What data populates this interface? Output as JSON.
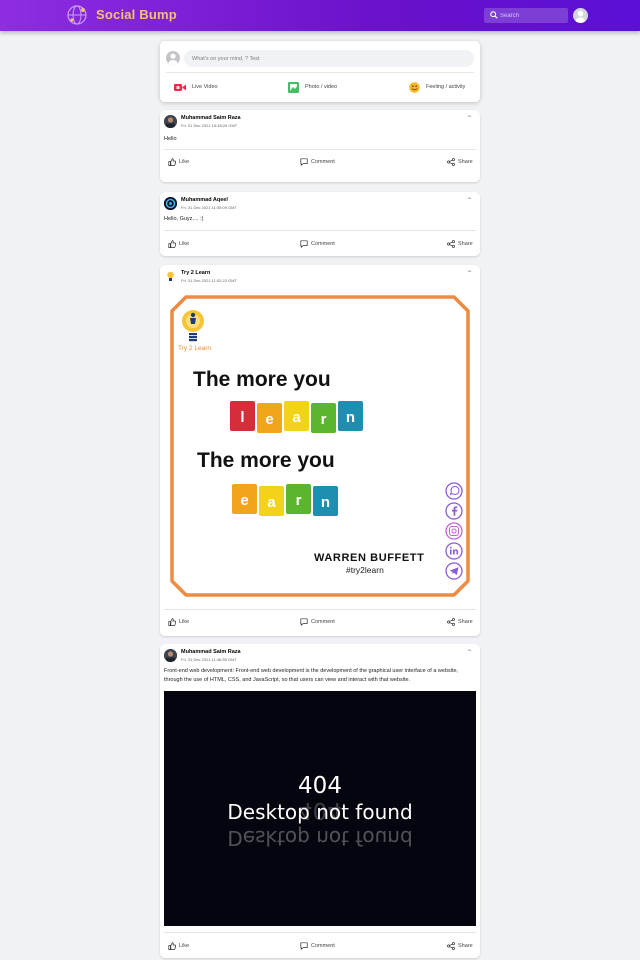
{
  "brand": {
    "name": "Social Bump"
  },
  "search": {
    "placeholder": "Search"
  },
  "composer": {
    "placeholder": "What's on your mind, ? Test",
    "actions": {
      "live": "Live Video",
      "photo": "Photo / video",
      "feeling": "Feeling / activity"
    }
  },
  "post_actions": {
    "like": "Like",
    "comment": "Comment",
    "share": "Share"
  },
  "posts": [
    {
      "author": "Muhammad Saim Raza",
      "date": "Fri, 31 Dec 2021 15:48:26 GMT",
      "text": "Hello"
    },
    {
      "author": "Muhammad Aqeel",
      "date": "Fri, 31 Dec 2021 11:55:09 GMT",
      "text": "Hello, Guyz.... :)"
    },
    {
      "author": "Try 2 Learn",
      "date": "Fri, 31 Dec 2021 11:52:22 GMT",
      "text": "",
      "image": {
        "logo_text": "Try 2 Learn",
        "line1": "The more you",
        "line2": "The more you",
        "learn_letters": [
          "l",
          "e",
          "a",
          "r",
          "n"
        ],
        "earn_letters": [
          "e",
          "a",
          "r",
          "n"
        ],
        "attribution": "WARREN BUFFETT",
        "hashtag": "#try2learn",
        "social_icons": [
          "whatsapp-icon",
          "facebook-icon",
          "instagram-icon",
          "linkedin-icon",
          "telegram-icon"
        ]
      }
    },
    {
      "author": "Muhammad Saim Raza",
      "date": "Fri, 31 Dec 2021 11:46:59 GMT",
      "text": "Front-end web development: Front-end web development is the development of the graphical user interface of a website, through the use of HTML, CSS, and JavaScript, so that users can view and interact with that website.",
      "image": {
        "code": "404",
        "message": "Desktop not found"
      }
    }
  ],
  "colors": {
    "header_start": "#8e2de2",
    "header_end": "#5b0fd6",
    "logo": "#f2c36b",
    "frame": "#f08a42"
  }
}
